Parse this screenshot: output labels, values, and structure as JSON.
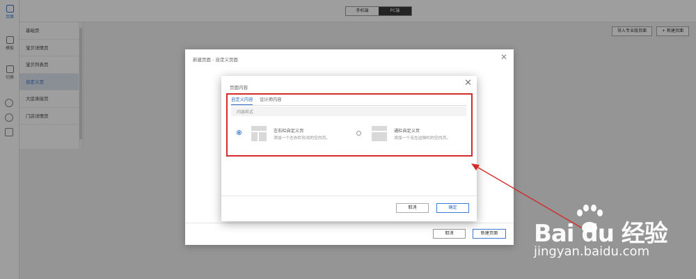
{
  "left_rail": {
    "page_label": "页面",
    "template_label": "模板",
    "switch_label": "切换"
  },
  "top_bar": {
    "tabs": [
      "手机端",
      "PC端"
    ]
  },
  "top_actions": {
    "import_label": "导入专业版页面",
    "new_label": "+ 新建页面"
  },
  "sub_nav": {
    "items": [
      "基础页",
      "宝贝详情页",
      "宝贝列表页",
      "自定义页",
      "大促承接页",
      "门店详情页"
    ]
  },
  "dialog_new_page": {
    "title": "新建页面 - 自定义页面",
    "cancel_label": "取消",
    "confirm_label": "新建页面"
  },
  "dialog_content": {
    "title": "页面内容",
    "tabs": [
      "自定义内容",
      "设计师内容"
    ],
    "section_label": "内容样式",
    "options": [
      {
        "title": "左右栏自定义页",
        "desc": "添加一个左右栏形式的空白页。"
      },
      {
        "title": "通栏自定义页",
        "desc": "添加一个无左边侧栏的空白页。"
      }
    ],
    "selected_option": 0,
    "cancel_label": "取消",
    "confirm_label": "确定"
  },
  "colors": {
    "accent": "#3a7bd5",
    "highlight": "#d42a2a"
  },
  "watermark": {
    "logo": "Bai du 经验",
    "url": "jingyan.baidu.com"
  }
}
